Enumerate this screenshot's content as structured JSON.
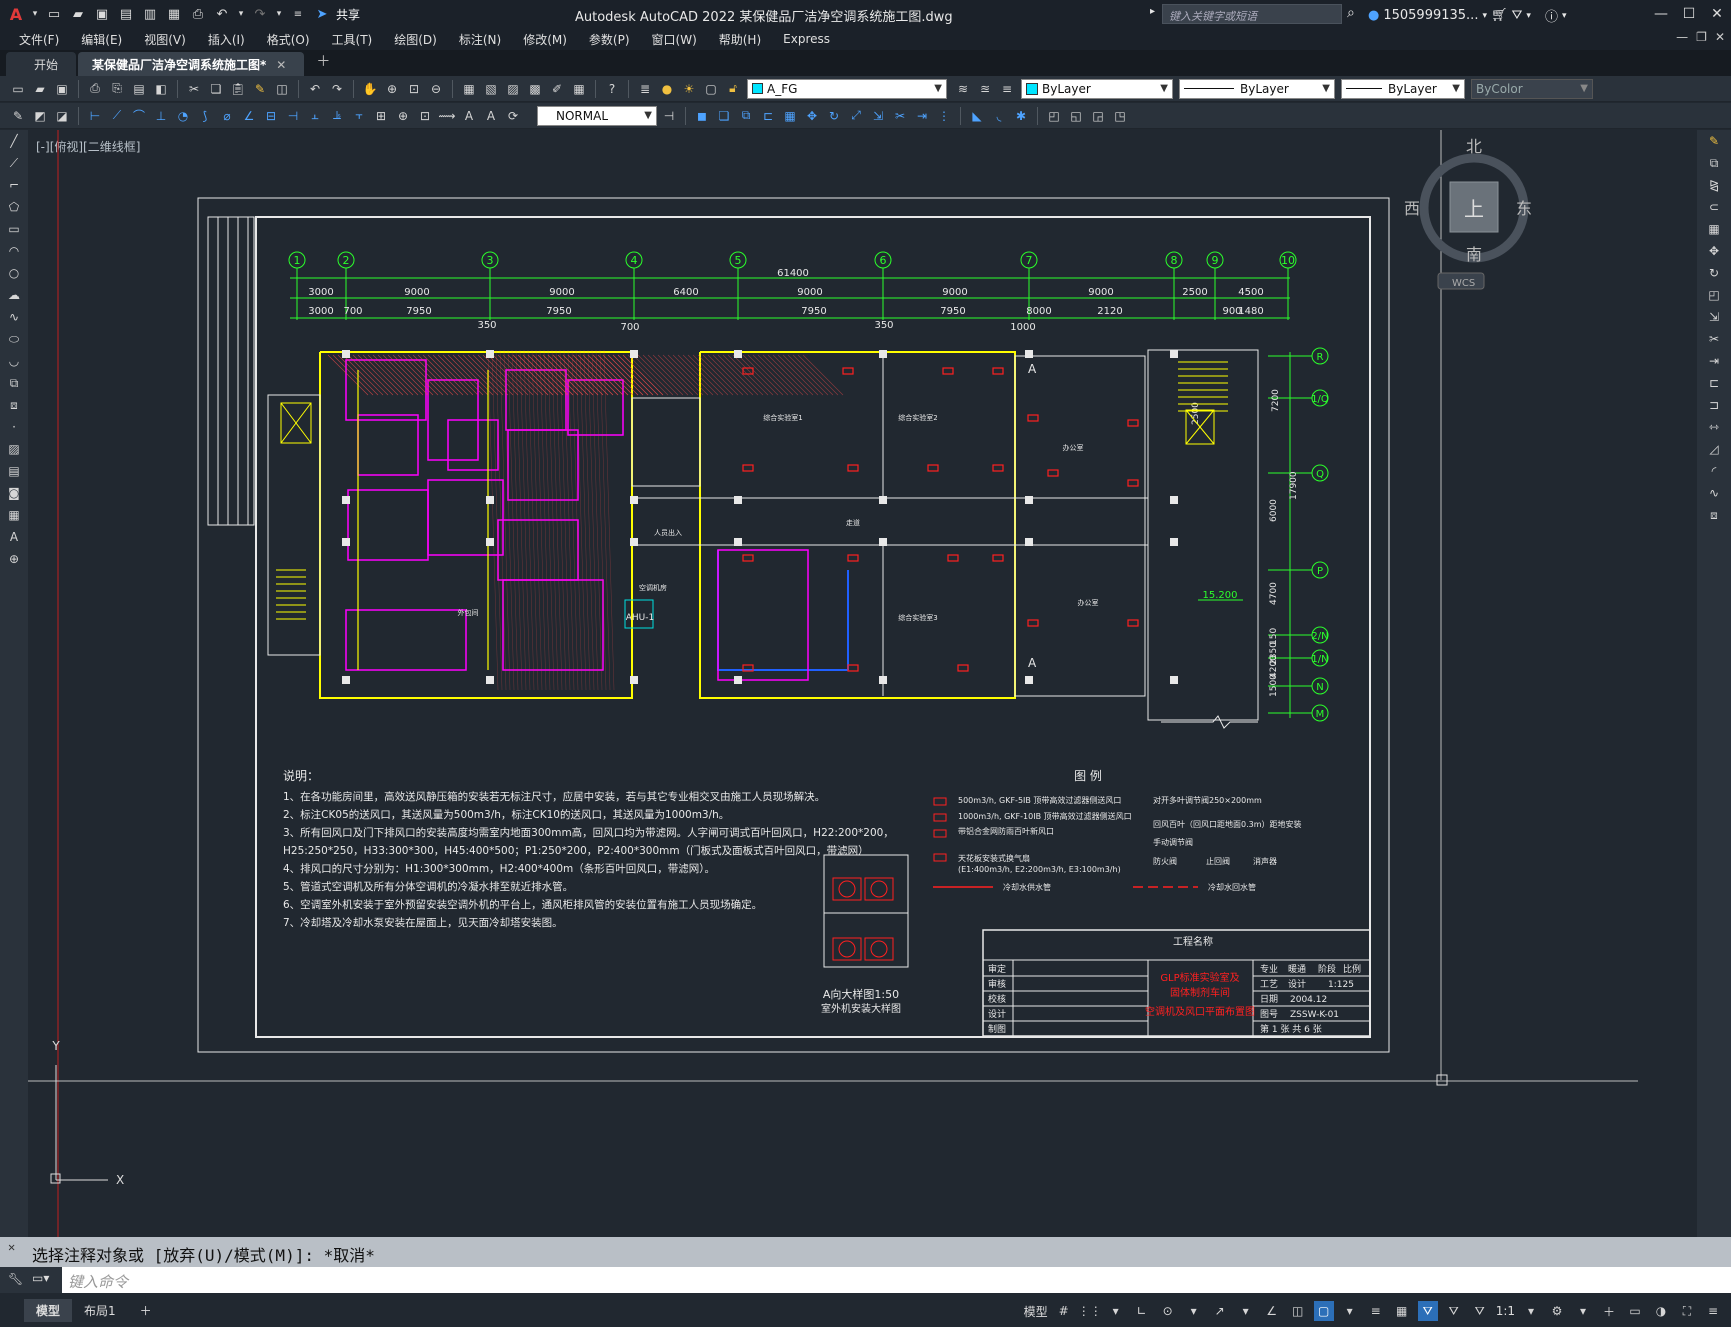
{
  "app": {
    "title": "Autodesk AutoCAD 2022    某保健品厂洁净空调系统施工图.dwg",
    "share_label": "共享",
    "search_placeholder": "键入关键字或短语",
    "user": "1505999135..."
  },
  "menu": [
    "文件(F)",
    "编辑(E)",
    "视图(V)",
    "插入(I)",
    "格式(O)",
    "工具(T)",
    "绘图(D)",
    "标注(N)",
    "修改(M)",
    "参数(P)",
    "窗口(W)",
    "帮助(H)",
    "Express"
  ],
  "tabs": [
    {
      "label": "开始",
      "active": false
    },
    {
      "label": "某保健品厂洁净空调系统施工图*",
      "active": true
    }
  ],
  "layers": {
    "layer_name": "A_FG",
    "color": "ByLayer",
    "linetype": "ByLayer",
    "lineweight": "ByLayer",
    "plotstyle": "ByColor",
    "dimstyle": "NORMAL"
  },
  "viewport_label": "[-][俯视][二维线框]",
  "viewcube": {
    "north": "北",
    "south": "南",
    "east": "东",
    "west": "西",
    "top": "上",
    "wcs": "WCS"
  },
  "drawing": {
    "axes_top": [
      "1",
      "2",
      "3",
      "4",
      "5",
      "6",
      "7",
      "8",
      "9",
      "10"
    ],
    "axes_right": [
      "R",
      "1/Q",
      "Q",
      "P",
      "2/N",
      "1/N",
      "N",
      "M"
    ],
    "total_dim": "61400",
    "dims_row1": [
      "3000",
      "9000",
      "9000",
      "6400",
      "9000",
      "9000",
      "9000",
      "2500",
      "4500"
    ],
    "dims_row2": [
      "3000",
      "700",
      "7950",
      "350",
      "7950",
      "700",
      "7950",
      "350",
      "7950",
      "1000",
      "8000",
      "2120",
      "900",
      "1480"
    ],
    "dims_right": [
      "7200",
      "2500",
      "17900",
      "6000",
      "4700",
      "150",
      "2350",
      "4200",
      "1500"
    ],
    "elevation": "15.200",
    "ahu": "AHU-1",
    "room_labels": [
      "综合实验室1",
      "综合实验室2",
      "综合实验室3",
      "办公室",
      "走道",
      "外包间",
      "人员出入",
      "空调机房",
      "办公室"
    ],
    "notes_title": "说明：",
    "notes": [
      "1、在各功能房间里，高效送风静压箱的安装若无标注尺寸，应居中安装，若与其它专业相交叉由施工人员现场解决。",
      "2、标注CK05的送风口，其送风量为500m3/h，标注CK10的送风口，其送风量为1000m3/h。",
      "3、所有回风口及门下排风口的安装高度均需室内地面300mm高，回风口均为带滤网。人字闸可调式百叶回风口，H22:200*200，",
      "   H25:250*250，H33:300*300，H45:400*500；P1:250*200，P2:400*300mm（门板式及面板式百叶回风口，带滤网）",
      "4、排风口的尺寸分别为：H1:300*300mm，H2:400*400m（条形百叶回风口，带滤网）。",
      "5、管道式空调机及所有分体空调机的冷凝水排至就近排水管。",
      "6、空调室外机安装于室外预留安装空调外机的平台上，通风柜排风管的安装位置有施工人员现场确定。",
      "7、冷却塔及冷却水泵安装在屋面上，见天面冷却塔安装图。"
    ],
    "legend_title": "图 例",
    "legend_items": [
      "500m3/h, GKF-5IB  顶带高效过滤器侧送风口",
      "1000m3/h, GKF-10IB  顶带高效过滤器侧送风口",
      "带铝合金网防雨百叶新风口",
      "天花板安装式换气扇",
      "(E1:400m3/h, E2:200m3/h, E3:100m3/h)",
      "冷却水供水管",
      "对开多叶调节阀250×200mm",
      "回风百叶（回风口距地面0.3m）距地安装",
      "手动调节阀",
      "防火阀",
      "止回阀",
      "消声器",
      "冷却水回水管"
    ],
    "detail_title": "A向大样图1:50",
    "detail_sub": "室外机安装大样图",
    "titleblock": {
      "project_label": "工程名称",
      "drawing_name_1": "GLP标准实验室及",
      "drawing_name_2": "固体制剂车间",
      "drawing_name_3": "空调机及风口平面布置图",
      "rows": [
        "审定",
        "审核",
        "校核",
        "设计",
        "制图"
      ],
      "scale": "1:125",
      "date": "2004.12",
      "number": "ZSSW-K-01",
      "sheet": "第 1 张  共 6 张",
      "spec_label": "专业",
      "spec_value": "暖通",
      "phase_label": "阶段",
      "phase_value": "施工",
      "ratio_label": "比例",
      "craft_label": "工艺",
      "design_label": "设计",
      "date_label": "日期",
      "no_label": "图号"
    }
  },
  "command": {
    "history": "选择注释对象或 [放弃(U)/模式(M)]: *取消*",
    "placeholder": "键入命令"
  },
  "status": {
    "tabs": [
      "模型",
      "布局1"
    ],
    "model_label": "模型",
    "scale": "1:1"
  }
}
